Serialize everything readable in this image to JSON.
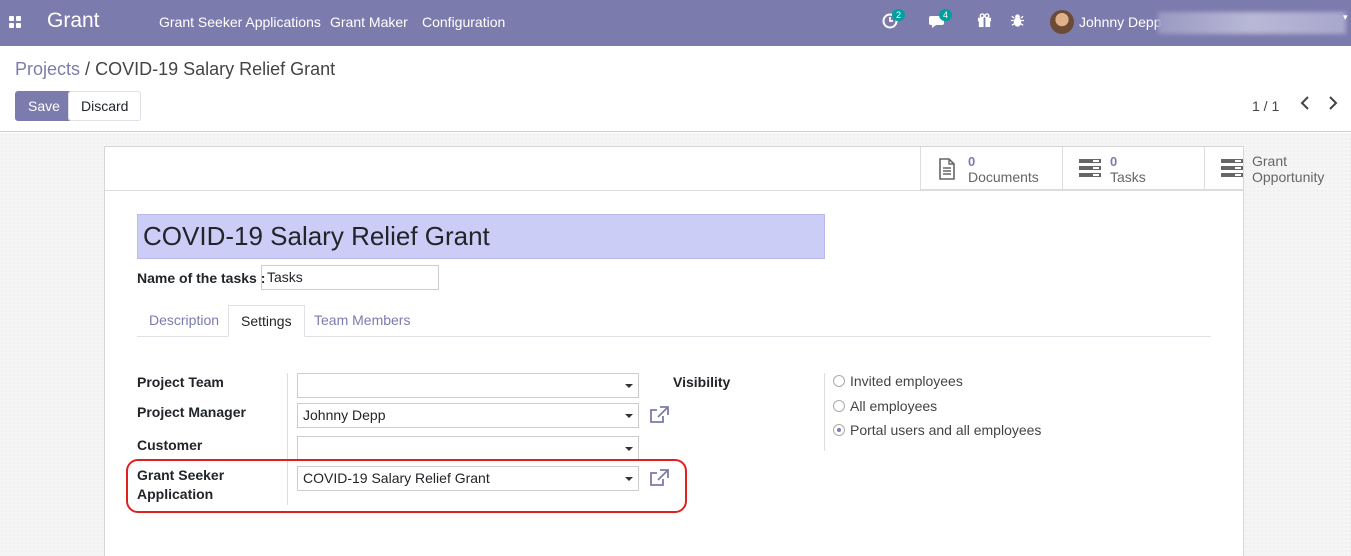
{
  "navbar": {
    "app_name": "Grant",
    "menu": [
      "Grant Seeker Applications",
      "Grant Maker",
      "Configuration"
    ],
    "activity_count": "2",
    "message_count": "4",
    "user_name": "Johnny Depp"
  },
  "breadcrumb": {
    "parent": "Projects",
    "separator": "/",
    "current": "COVID-19 Salary Relief Grant"
  },
  "actions": {
    "save_label": "Save",
    "discard_label": "Discard"
  },
  "pager": {
    "value": "1 / 1"
  },
  "stat_buttons": {
    "documents": {
      "value": "0",
      "label": "Documents"
    },
    "tasks": {
      "value": "0",
      "label": "Tasks"
    },
    "grant_opportunity": {
      "label_line1": "Grant",
      "label_line2": "Opportunity"
    }
  },
  "form": {
    "project_name": "COVID-19 Salary Relief Grant",
    "tasks_label": "Name of the tasks :",
    "tasks_value": "Tasks"
  },
  "tabs": [
    "Description",
    "Settings",
    "Team Members"
  ],
  "settings": {
    "project_team_label": "Project Team",
    "project_team_value": "",
    "project_manager_label": "Project Manager",
    "project_manager_value": "Johnny Depp",
    "customer_label": "Customer",
    "customer_value": "",
    "grant_seeker_label_line1": "Grant Seeker",
    "grant_seeker_label_line2": "Application",
    "grant_seeker_value": "COVID-19 Salary Relief Grant",
    "visibility_label": "Visibility",
    "visibility_options": [
      "Invited employees",
      "All employees",
      "Portal users and all employees"
    ],
    "visibility_selected": "Portal users and all employees"
  },
  "colors": {
    "brand": "#7c7bad",
    "title_highlight": "#cccdf7",
    "annotation": "#e02020"
  }
}
